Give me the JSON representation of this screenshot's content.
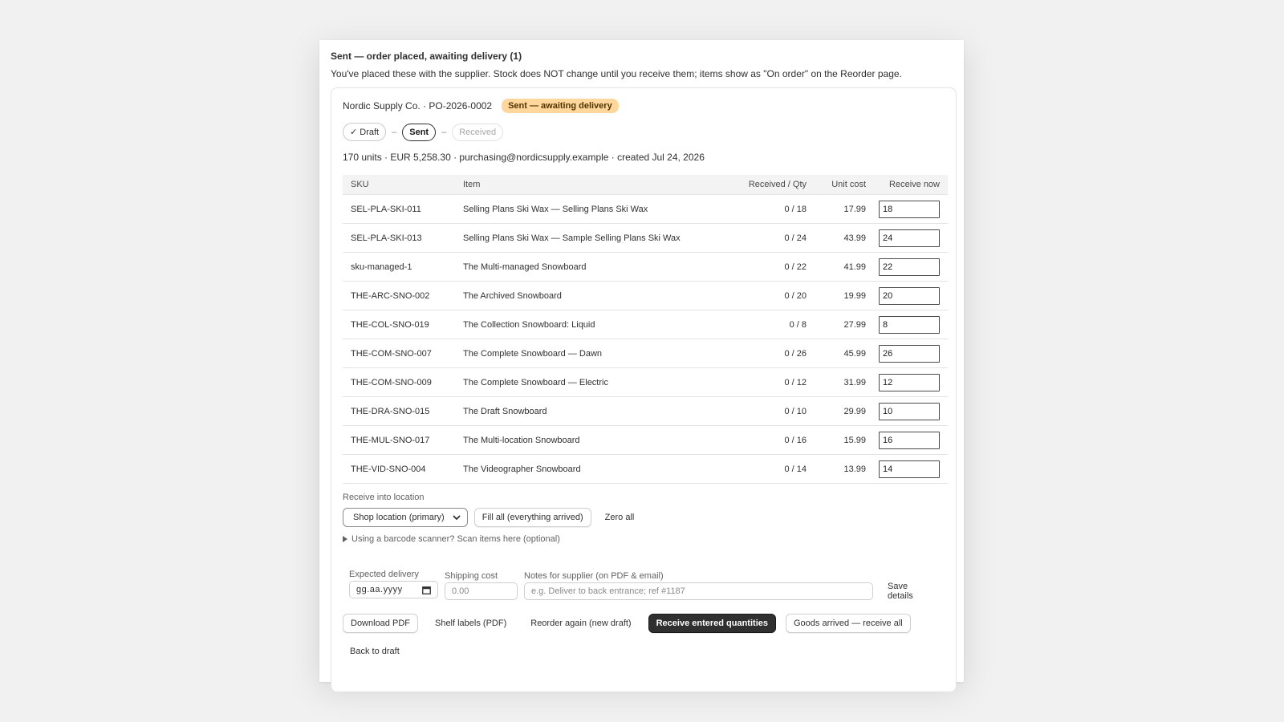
{
  "section": {
    "title": "Sent — order placed, awaiting delivery (1)",
    "description": "You've placed these with the supplier. Stock does NOT change until you receive them; items show as \"On order\" on the Reorder page."
  },
  "order": {
    "supplier": "Nordic Supply Co. · PO-2026-0002",
    "status_badge": "Sent — awaiting delivery",
    "badge_color": "#ffd79d",
    "steps": [
      "✓ Draft",
      "Sent",
      "Received"
    ],
    "step_separator": "–",
    "summary": "170 units · EUR 5,258.30 · purchasing@nordicsupply.example · created Jul 24, 2026"
  },
  "table": {
    "headers": [
      "SKU",
      "Item",
      "Received / Qty",
      "Unit cost",
      "Receive now"
    ],
    "rows": [
      {
        "sku": "SEL-PLA-SKI-011",
        "item": "Selling Plans Ski Wax — Selling Plans Ski Wax",
        "received": "0 / 18",
        "cost": "17.99",
        "now": "18"
      },
      {
        "sku": "SEL-PLA-SKI-013",
        "item": "Selling Plans Ski Wax — Sample Selling Plans Ski Wax",
        "received": "0 / 24",
        "cost": "43.99",
        "now": "24"
      },
      {
        "sku": "sku-managed-1",
        "item": "The Multi-managed Snowboard",
        "received": "0 / 22",
        "cost": "41.99",
        "now": "22"
      },
      {
        "sku": "THE-ARC-SNO-002",
        "item": "The Archived Snowboard",
        "received": "0 / 20",
        "cost": "19.99",
        "now": "20"
      },
      {
        "sku": "THE-COL-SNO-019",
        "item": "The Collection Snowboard: Liquid",
        "received": "0 / 8",
        "cost": "27.99",
        "now": "8"
      },
      {
        "sku": "THE-COM-SNO-007",
        "item": "The Complete Snowboard — Dawn",
        "received": "0 / 26",
        "cost": "45.99",
        "now": "26"
      },
      {
        "sku": "THE-COM-SNO-009",
        "item": "The Complete Snowboard — Electric",
        "received": "0 / 12",
        "cost": "31.99",
        "now": "12"
      },
      {
        "sku": "THE-DRA-SNO-015",
        "item": "The Draft Snowboard",
        "received": "0 / 10",
        "cost": "29.99",
        "now": "10"
      },
      {
        "sku": "THE-MUL-SNO-017",
        "item": "The Multi-location Snowboard",
        "received": "0 / 16",
        "cost": "15.99",
        "now": "16"
      },
      {
        "sku": "THE-VID-SNO-004",
        "item": "The Videographer Snowboard",
        "received": "0 / 14",
        "cost": "13.99",
        "now": "14"
      }
    ]
  },
  "receive": {
    "location_label": "Receive into location",
    "location_value": "Shop location (primary)",
    "fill_all": "Fill all (everything arrived)",
    "zero_all": "Zero all",
    "scanner": "Using a barcode scanner? Scan items here (optional)"
  },
  "details": {
    "expected_label": "Expected delivery",
    "expected_value": "gg.aa.yyyy",
    "shipping_label": "Shipping cost",
    "shipping_placeholder": "0.00",
    "notes_label": "Notes for supplier (on PDF & email)",
    "notes_placeholder": "e.g. Deliver to back entrance; ref #1187",
    "save": "Save details"
  },
  "actions": {
    "download_pdf": "Download PDF",
    "shelf_labels": "Shelf labels (PDF)",
    "reorder_again": "Reorder again (new draft)",
    "receive_entered": "Receive entered quantities",
    "receive_all": "Goods arrived — receive all",
    "back_to_draft": "Back to draft"
  }
}
